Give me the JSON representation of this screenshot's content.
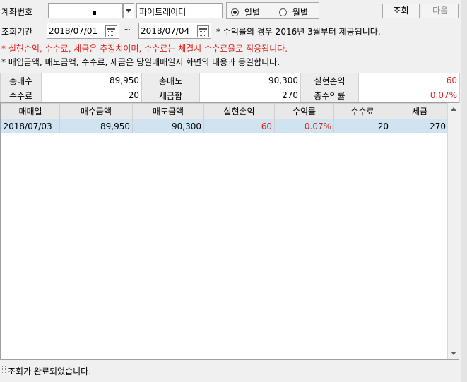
{
  "toolbar": {
    "account_label": "계좌번호",
    "account_value": "",
    "account_name": "파이트레이더",
    "radio_daily": "일별",
    "radio_monthly": "월별",
    "query_button": "조회",
    "next_button": "다음"
  },
  "period": {
    "label": "조회기간",
    "start": "2018/07/01",
    "separator": "~",
    "end": "2018/07/04",
    "note": "* 수익률의 경우 2016년 3월부터 제공됩니다."
  },
  "notices": {
    "line1": "* 실현손익, 수수료, 세금은 추정치이며, 수수료는 체결시 수수료율로 적용됩니다.",
    "line2": "* 매입금액, 매도금액, 수수료, 세금은 당일매매일지 화면의 내용과 동일합니다."
  },
  "summary": {
    "total_buy_label": "총매수",
    "total_buy_value": "89,950",
    "total_sell_label": "총매도",
    "total_sell_value": "90,300",
    "realized_label": "실현손익",
    "realized_value": "60",
    "fee_label": "수수료",
    "fee_value": "20",
    "tax_label": "세금합",
    "tax_value": "270",
    "total_return_label": "총수익률",
    "total_return_value": "0.07%"
  },
  "grid": {
    "columns": [
      "매매일",
      "매수금액",
      "매도금액",
      "실현손익",
      "수익률",
      "수수료",
      "세금"
    ],
    "rows": [
      [
        "2018/07/03",
        "89,950",
        "90,300",
        "60",
        "0.07%",
        "20",
        "270"
      ]
    ]
  },
  "status": {
    "text": "조회가 완료되었습니다."
  },
  "colors": {
    "profit": "#e0201a",
    "selected_row": "#cfe3f0"
  }
}
